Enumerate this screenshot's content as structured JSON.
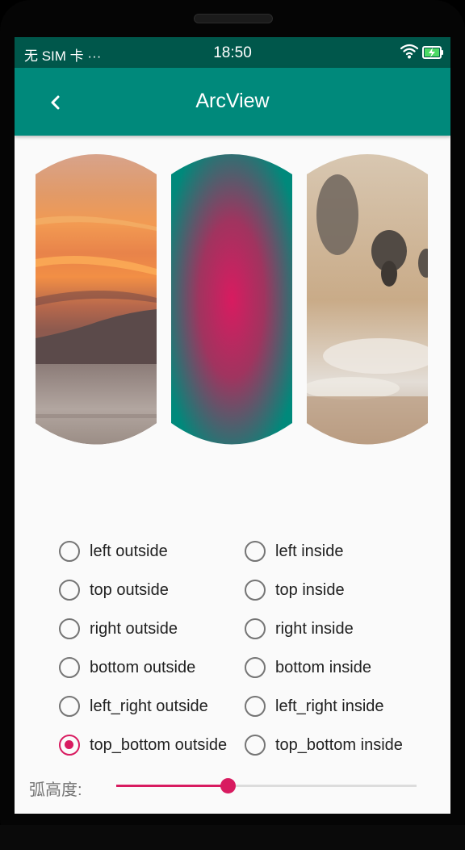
{
  "status_bar": {
    "carrier": "无 SIM 卡 ···",
    "time": "18:50",
    "wifi_icon": "wifi-icon",
    "battery_icon": "battery-charging-icon"
  },
  "app_bar": {
    "title": "ArcView",
    "back_icon": "chevron-left-icon"
  },
  "arc_views": [
    {
      "name": "sunset-arc-image",
      "kind": "photo"
    },
    {
      "name": "gradient-arc-view",
      "kind": "radial-gradient",
      "colors": [
        "#d81b60",
        "#00897b"
      ]
    },
    {
      "name": "wildebeest-arc-image",
      "kind": "photo"
    }
  ],
  "radio_options": {
    "left_outside": "left outside",
    "left_inside": "left inside",
    "top_outside": "top outside",
    "top_inside": "top inside",
    "right_outside": "right outside",
    "right_inside": "right inside",
    "bottom_outside": "bottom outside",
    "bottom_inside": "bottom inside",
    "left_right_outside": "left_right outside",
    "left_right_inside": "left_right inside",
    "top_bottom_outside": "top_bottom outside",
    "top_bottom_inside": "top_bottom inside",
    "selected": "top_bottom outside"
  },
  "slider": {
    "label": "弧高度:",
    "value_fraction": 0.37
  },
  "colors": {
    "primary": "#00897b",
    "primary_dark": "#00574b",
    "accent": "#d81b60"
  }
}
